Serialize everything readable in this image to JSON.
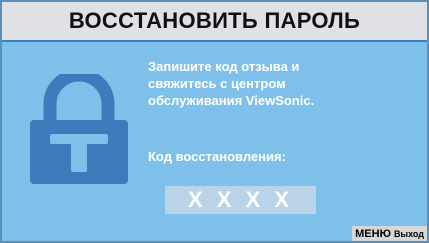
{
  "dialog": {
    "title": "ВОССТАНОВИТЬ ПАРОЛЬ",
    "message_lines": [
      "Запишите код отзыва и",
      "свяжитесь с центром",
      "обслуживания ViewSonic."
    ],
    "recall_code_label": "Код восстановления:",
    "recall_code_value": "X X X X"
  },
  "footer": {
    "menu_button": "МЕНЮ",
    "exit_label": "Выход"
  },
  "icons": {
    "lock": "padlock-icon"
  },
  "colors": {
    "background": "#7fc0ea",
    "titlebar": "#dfe1e4",
    "lock_body": "#3d7bbd",
    "code_box": "#b9d4e8"
  }
}
